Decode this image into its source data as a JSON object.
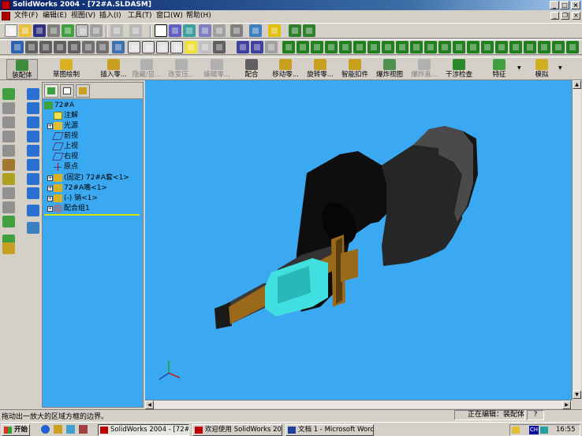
{
  "window": {
    "title": "SolidWorks 2004 - [72#A.SLDASM]"
  },
  "menu": {
    "items": [
      "文件(F)",
      "编辑(E)",
      "视图(V)",
      "插入(I)",
      "工具(T)",
      "窗口(W)",
      "帮助(H)"
    ]
  },
  "command_bar": {
    "items": [
      {
        "label": "装配体",
        "enabled": true
      },
      {
        "label": "草图绘制",
        "enabled": true
      },
      {
        "label": "插入零...",
        "enabled": true
      },
      {
        "label": "隐藏/显...",
        "enabled": false
      },
      {
        "label": "改变压...",
        "enabled": false
      },
      {
        "label": "编辑零...",
        "enabled": false
      },
      {
        "label": "配合",
        "enabled": true
      },
      {
        "label": "移动零...",
        "enabled": true
      },
      {
        "label": "旋转零...",
        "enabled": true
      },
      {
        "label": "智能扣件",
        "enabled": true
      },
      {
        "label": "爆炸视图",
        "enabled": true
      },
      {
        "label": "爆炸直...",
        "enabled": false
      },
      {
        "label": "干涉检查",
        "enabled": true
      },
      {
        "label": "特征",
        "enabled": true
      },
      {
        "label": "模拟",
        "enabled": true
      }
    ]
  },
  "feature_tree": {
    "root": "72#A",
    "items": [
      {
        "label": "注解",
        "icon": "annotation-icon",
        "expandable": false
      },
      {
        "label": "光源",
        "icon": "lights-icon",
        "expandable": true
      },
      {
        "label": "前视",
        "icon": "plane-icon",
        "expandable": false
      },
      {
        "label": "上视",
        "icon": "plane-icon",
        "expandable": false
      },
      {
        "label": "右视",
        "icon": "plane-icon",
        "expandable": false
      },
      {
        "label": "原点",
        "icon": "origin-icon",
        "expandable": false
      },
      {
        "label": "(固定) 72#A套<1>",
        "icon": "part-icon",
        "expandable": true
      },
      {
        "label": "72#A嘴<1>",
        "icon": "part-icon",
        "expandable": true
      },
      {
        "label": "(-) 销<1>",
        "icon": "part-icon",
        "expandable": true
      },
      {
        "label": "配合组1",
        "icon": "mates-icon",
        "expandable": true
      }
    ]
  },
  "status": {
    "hint": "拖动出一放大的区域方框的边界。",
    "editing": "正在编辑：装配体",
    "help": "?"
  },
  "taskbar": {
    "start": "开始",
    "tasks": [
      "SolidWorks 2004 - [72#A....",
      "欢迎使用 SolidWorks 2004",
      "文档 1 - Microsoft Word"
    ],
    "ime": "CH",
    "clock": "16:55"
  },
  "colors": {
    "viewport": "#3ba9f2",
    "title_gradient_start": "#0a246a",
    "part_body": "#2a2a2a",
    "section_bronze": "#9a6a1a",
    "section_cyan": "#40e0e0"
  }
}
